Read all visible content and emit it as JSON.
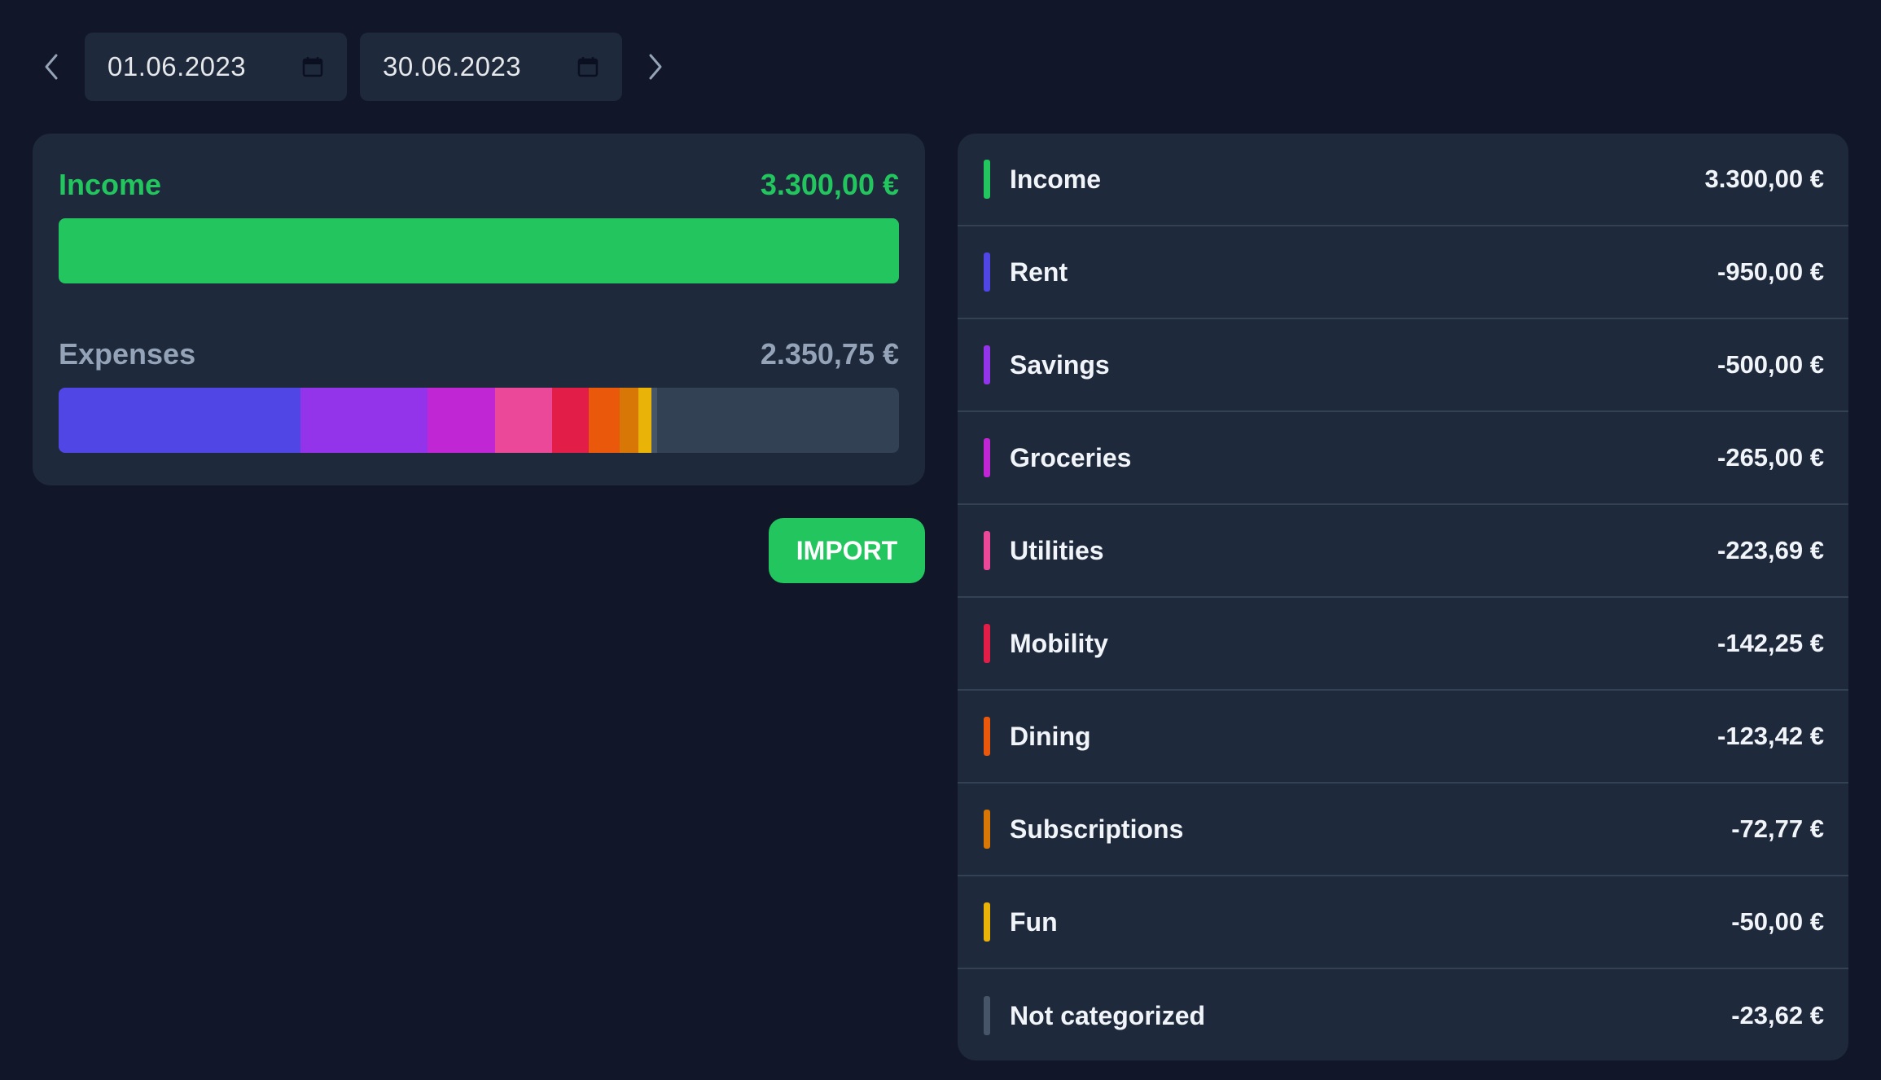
{
  "date_range": {
    "start": "01.06.2023",
    "end": "30.06.2023",
    "prev_icon": "chevron-left-icon",
    "next_icon": "chevron-right-icon",
    "calendar_icon": "calendar-icon"
  },
  "summary": {
    "income_label": "Income",
    "income_value": "3.300,00 €",
    "expenses_label": "Expenses",
    "expenses_value": "2.350,75 €",
    "income_color": "#22c55e",
    "expenses_bar": [
      {
        "name": "Rent",
        "amount": 950.0,
        "color": "#4f46e5"
      },
      {
        "name": "Savings",
        "amount": 500.0,
        "color": "#9333ea"
      },
      {
        "name": "Groceries",
        "amount": 265.0,
        "color": "#c026d3"
      },
      {
        "name": "Utilities",
        "amount": 223.69,
        "color": "#ec4899"
      },
      {
        "name": "Mobility",
        "amount": 142.25,
        "color": "#e11d48"
      },
      {
        "name": "Dining",
        "amount": 123.42,
        "color": "#ea580c"
      },
      {
        "name": "Subscriptions",
        "amount": 72.77,
        "color": "#d97706"
      },
      {
        "name": "Fun",
        "amount": 50.0,
        "color": "#eab308"
      },
      {
        "name": "Not categorized",
        "amount": 23.62,
        "color": "#475569"
      }
    ],
    "expenses_total_scale": 3300.0
  },
  "import_label": "IMPORT",
  "categories": [
    {
      "name": "Income",
      "amount": "3.300,00 €",
      "color": "#22c55e"
    },
    {
      "name": "Rent",
      "amount": "-950,00 €",
      "color": "#4f46e5"
    },
    {
      "name": "Savings",
      "amount": "-500,00 €",
      "color": "#9333ea"
    },
    {
      "name": "Groceries",
      "amount": "-265,00 €",
      "color": "#c026d3"
    },
    {
      "name": "Utilities",
      "amount": "-223,69 €",
      "color": "#ec4899"
    },
    {
      "name": "Mobility",
      "amount": "-142,25 €",
      "color": "#e11d48"
    },
    {
      "name": "Dining",
      "amount": "-123,42 €",
      "color": "#ea580c"
    },
    {
      "name": "Subscriptions",
      "amount": "-72,77 €",
      "color": "#d97706"
    },
    {
      "name": "Fun",
      "amount": "-50,00 €",
      "color": "#eab308"
    },
    {
      "name": "Not categorized",
      "amount": "-23,62 €",
      "color": "#475569"
    }
  ]
}
